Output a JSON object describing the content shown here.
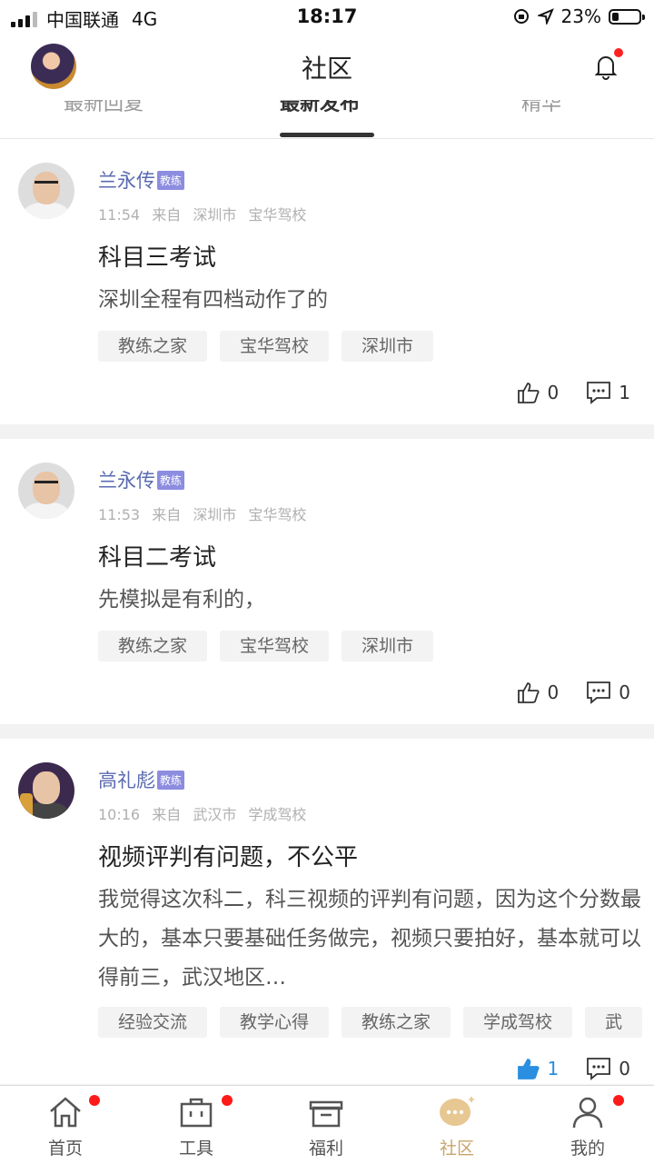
{
  "status_bar": {
    "carrier": "中国联通",
    "network": "4G",
    "time": "18:17",
    "battery": "23%"
  },
  "header": {
    "title": "社区"
  },
  "tabs": [
    {
      "label": "最新回复"
    },
    {
      "label": "最新发布"
    },
    {
      "label": "精华"
    }
  ],
  "posts": [
    {
      "author": "兰永传",
      "badge": "教练",
      "time": "11:54",
      "source_prefix": "来自",
      "city": "深圳市",
      "school": "宝华驾校",
      "title": "科目三考试",
      "body": "深圳全程有四档动作了的",
      "tags": [
        "教练之家",
        "宝华驾校",
        "深圳市"
      ],
      "likes": "0",
      "comments": "1"
    },
    {
      "author": "兰永传",
      "badge": "教练",
      "time": "11:53",
      "source_prefix": "来自",
      "city": "深圳市",
      "school": "宝华驾校",
      "title": "科目二考试",
      "body": "先模拟是有利的，",
      "tags": [
        "教练之家",
        "宝华驾校",
        "深圳市"
      ],
      "likes": "0",
      "comments": "0"
    },
    {
      "author": "高礼彪",
      "badge": "教练",
      "time": "10:16",
      "source_prefix": "来自",
      "city": "武汉市",
      "school": "学成驾校",
      "title": "视频评判有问题，不公平",
      "body": "我觉得这次科二，科三视频的评判有问题，因为这个分数最大的，基本只要基础任务做完，视频只要拍好，基本就可以得前三，武汉地区…",
      "tags": [
        "经验交流",
        "教学心得",
        "教练之家",
        "学成驾校",
        "武"
      ],
      "likes": "1",
      "comments": "0"
    }
  ],
  "tabbar": [
    {
      "label": "首页",
      "icon": "home-icon"
    },
    {
      "label": "工具",
      "icon": "toolbox-icon"
    },
    {
      "label": "福利",
      "icon": "gift-icon"
    },
    {
      "label": "社区",
      "icon": "chat-bubble-icon"
    },
    {
      "label": "我的",
      "icon": "person-icon"
    }
  ],
  "colors": {
    "author": "#5a6bb0",
    "badge": "#8c8ce0",
    "active_tab": "#c9a46a",
    "notification_dot": "#ff1a1a",
    "liked": "#2a8fe0"
  }
}
